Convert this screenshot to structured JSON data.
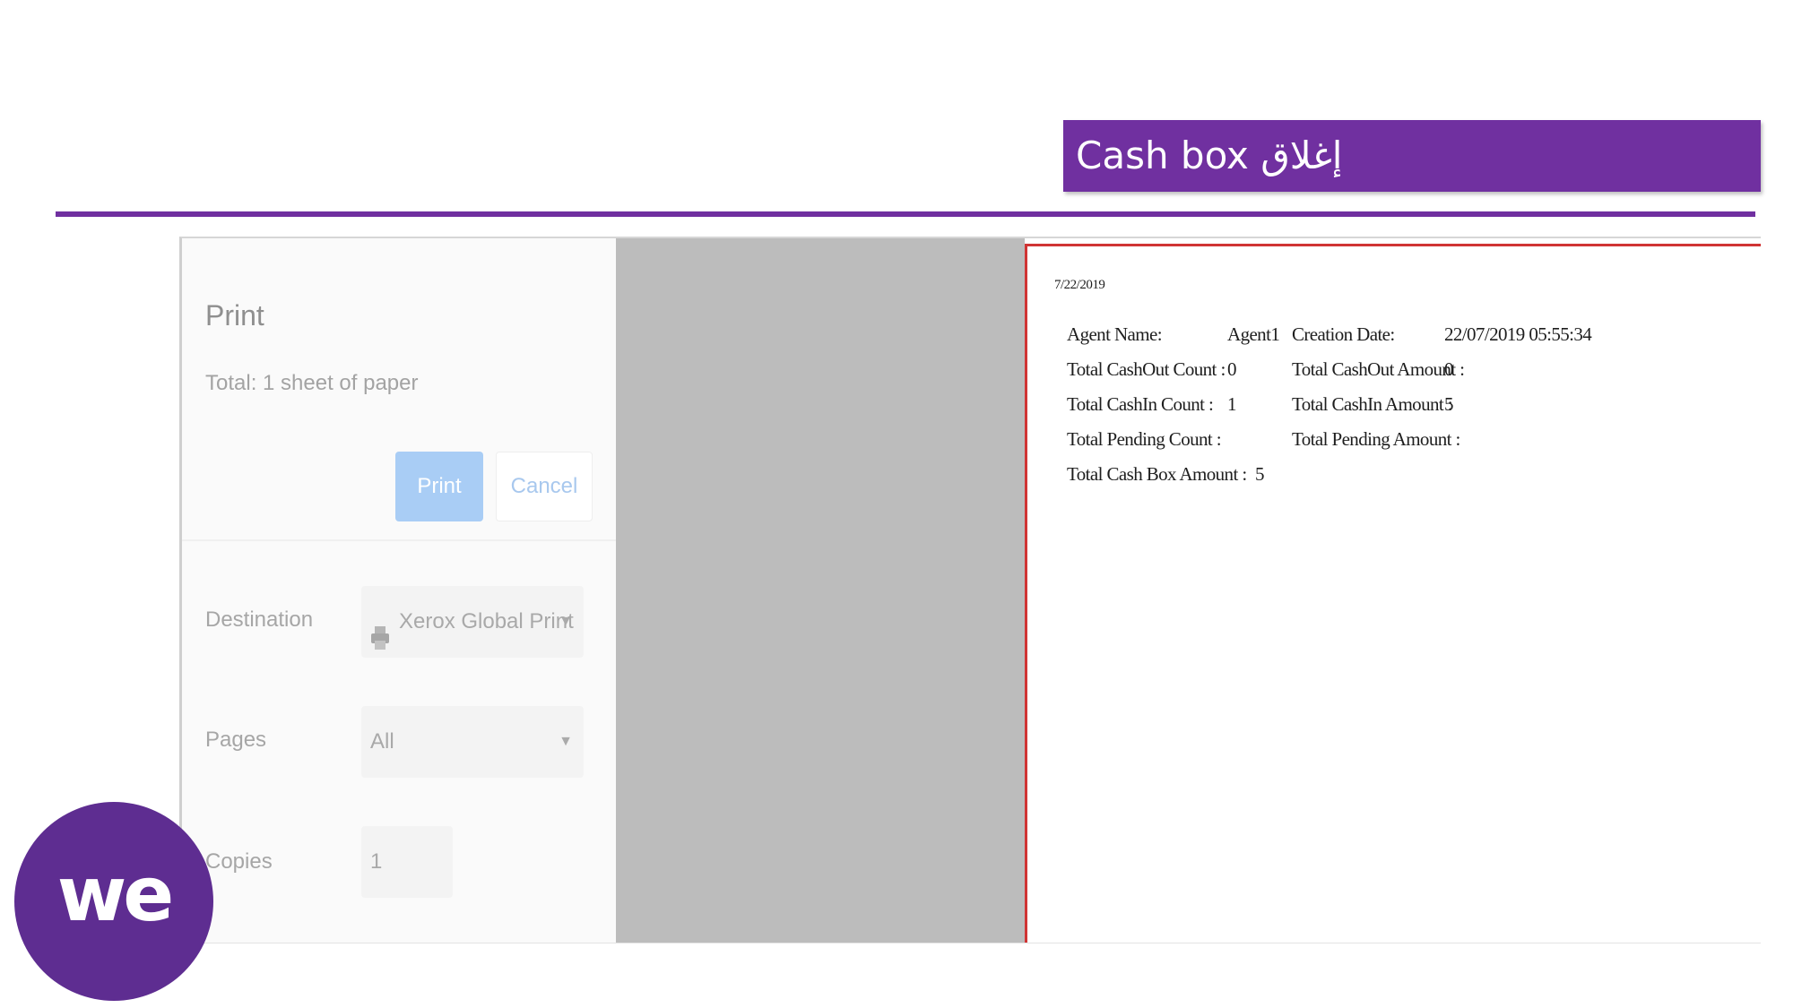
{
  "slide": {
    "title": "Cash box إغلاق",
    "brand_color": "#7030a0",
    "logo_text": "we"
  },
  "print_dialog": {
    "title": "Print",
    "total": "Total: 1 sheet of paper",
    "print_button": "Print",
    "cancel_button": "Cancel",
    "destination_label": "Destination",
    "destination_value": "Xerox Global Print",
    "pages_label": "Pages",
    "pages_value": "All",
    "copies_label": "Copies",
    "copies_value": "1"
  },
  "preview": {
    "date": "7/22/2019",
    "agent_name_label": "Agent Name:",
    "agent_name_value": "Agent1",
    "creation_date_label": "Creation Date:",
    "creation_date_value": "22/07/2019 05:55:34",
    "cashout_count_label": "Total CashOut Count :",
    "cashout_count_value": "0",
    "cashout_amount_label": "Total CashOut Amount :",
    "cashout_amount_value": "0",
    "cashin_count_label": "Total CashIn Count :",
    "cashin_count_value": "1",
    "cashin_amount_label": "Total CashIn Amount :",
    "cashin_amount_value": "5",
    "pending_count_label": "Total Pending Count :",
    "pending_amount_label": "Total Pending Amount :",
    "cash_box_amount_label": "Total Cash Box Amount :",
    "cash_box_amount_value": "5"
  }
}
